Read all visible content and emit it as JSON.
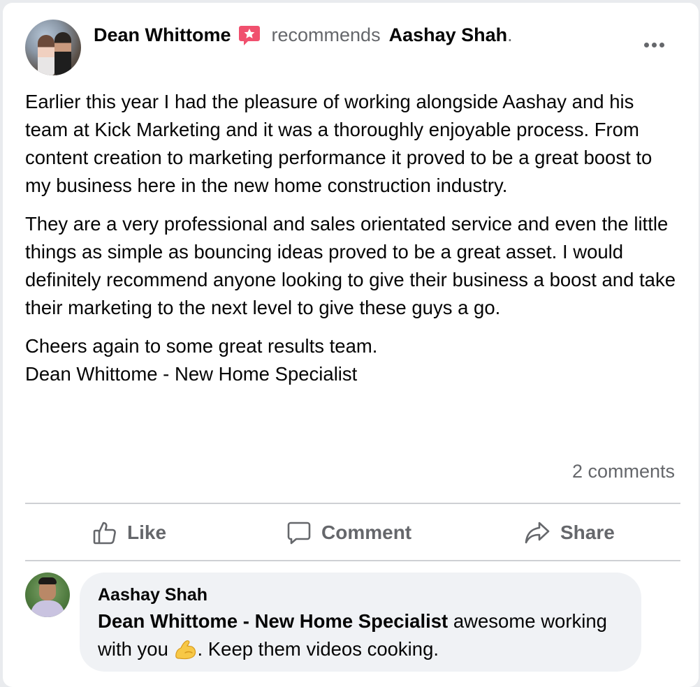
{
  "post": {
    "author": "Dean Whittome",
    "recommends_label": "recommends",
    "target": "Aashay Shah",
    "target_suffix": ".",
    "paragraphs": [
      "Earlier this year I had the pleasure of working alongside Aashay and his team at Kick Marketing and it was a thoroughly enjoyable process. From content creation to marketing performance it proved to be a great boost to my business here in the new home construction industry.",
      "They are a very professional and sales orientated service and even the little things as simple as bouncing ideas proved to be a great asset. I would definitely recommend anyone looking to give their business a boost and take their marketing to the next level to give these guys a go."
    ],
    "closing_line1": "Cheers again to some great results team.",
    "closing_line2": "Dean Whittome - New Home Specialist",
    "comments_count": "2 comments",
    "recommend_icon": "recommend-star-icon",
    "more_icon": "more-options-icon"
  },
  "actions": {
    "like": {
      "label": "Like",
      "icon": "thumbs-up-icon"
    },
    "comment": {
      "label": "Comment",
      "icon": "comment-bubble-icon"
    },
    "share": {
      "label": "Share",
      "icon": "share-arrow-icon"
    }
  },
  "comment": {
    "author": "Aashay Shah",
    "mention": "Dean Whittome - New Home Specialist",
    "text_part1": " awesome working with you ",
    "emoji": "flexed-biceps-emoji",
    "text_part2": ". Keep them videos cooking."
  },
  "colors": {
    "recommend_badge": "#f0506e",
    "secondary_text": "#65676b",
    "bubble_bg": "#f0f2f5"
  }
}
